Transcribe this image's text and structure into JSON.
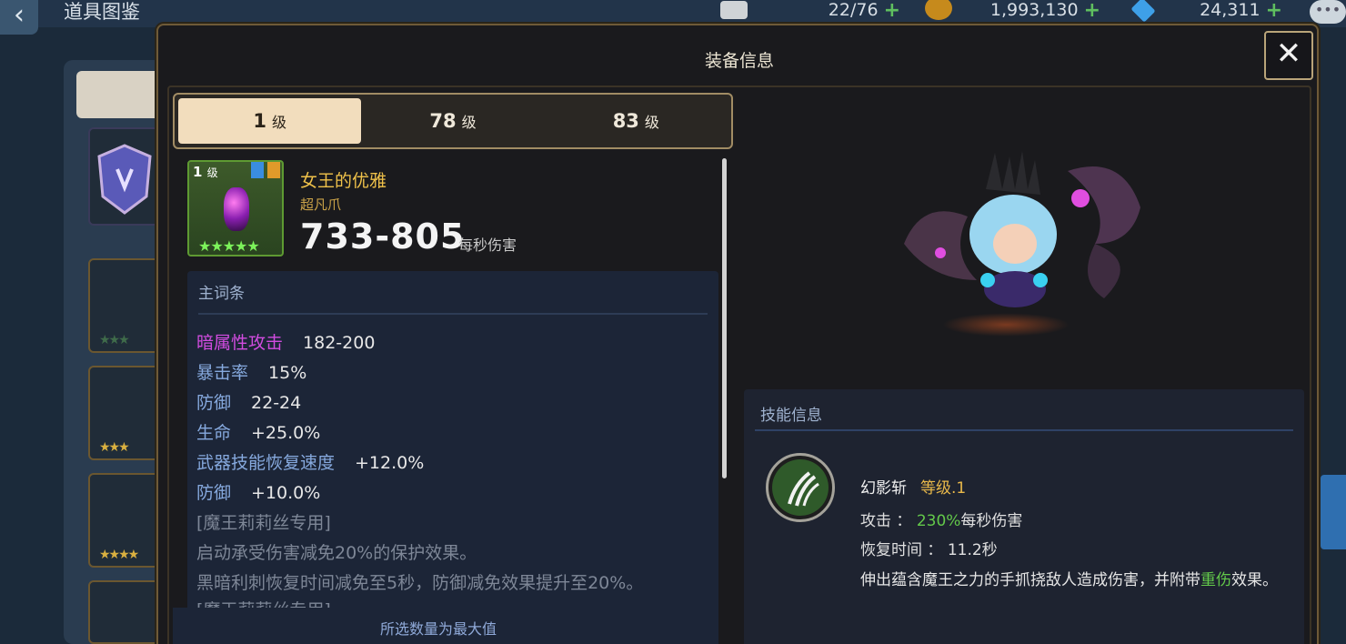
{
  "topbar": {
    "back_glyph": "‹",
    "page_title": "道具图鉴",
    "stamina": "22/76",
    "gold": "1,993,130",
    "gems": "24,311",
    "plus": "+",
    "chat_glyph": "•••"
  },
  "modal": {
    "title": "装备信息",
    "close_glyph": "✕"
  },
  "level_tabs": [
    {
      "value": "1",
      "unit": "级",
      "active": true
    },
    {
      "value": "78",
      "unit": "级",
      "active": false
    },
    {
      "value": "83",
      "unit": "级",
      "active": false
    }
  ],
  "item": {
    "level": "1",
    "level_unit": "级",
    "stars": "★★★★★",
    "name": "女王的优雅",
    "type": "超凡爪",
    "dps": "733-805",
    "dps_unit": "每秒伤害"
  },
  "stats": {
    "header": "主词条",
    "rows": [
      {
        "key": "暗属性攻击",
        "value": "182-200"
      },
      {
        "key": "暴击率",
        "value": "15%"
      },
      {
        "key": "防御",
        "value": "22-24"
      },
      {
        "key": "生命",
        "value": "+25.0%"
      },
      {
        "key": "武器技能恢复速度",
        "value": "+12.0%"
      },
      {
        "key": "防御",
        "value": "+10.0%"
      }
    ],
    "notes": [
      "[魔王莉莉丝专用]",
      "启动承受伤害减免20%的保护效果。",
      "黑暗利刺恢复时间减免至5秒，防御减免效果提升至20%。",
      "[魔王莉莉丝专用]"
    ],
    "max_note": "所选数量为最大值"
  },
  "skill": {
    "title": "技能信息",
    "icon": "claw-slash-icon",
    "name": "幻影斩",
    "level": "等级.1",
    "attack_label": "攻击 ：",
    "attack_pct": "230%",
    "attack_unit": "每秒伤害",
    "cooldown_label": "恢复时间 ：",
    "cooldown_value": "11.2秒",
    "desc_before": "伸出蕴含魔王之力的手抓挠敌人造成伤害，并附带",
    "desc_highlight": "重伤",
    "desc_after": "效果。"
  },
  "side_slots": [
    "★★★",
    "★★★",
    "★★★★",
    "★★★★"
  ]
}
